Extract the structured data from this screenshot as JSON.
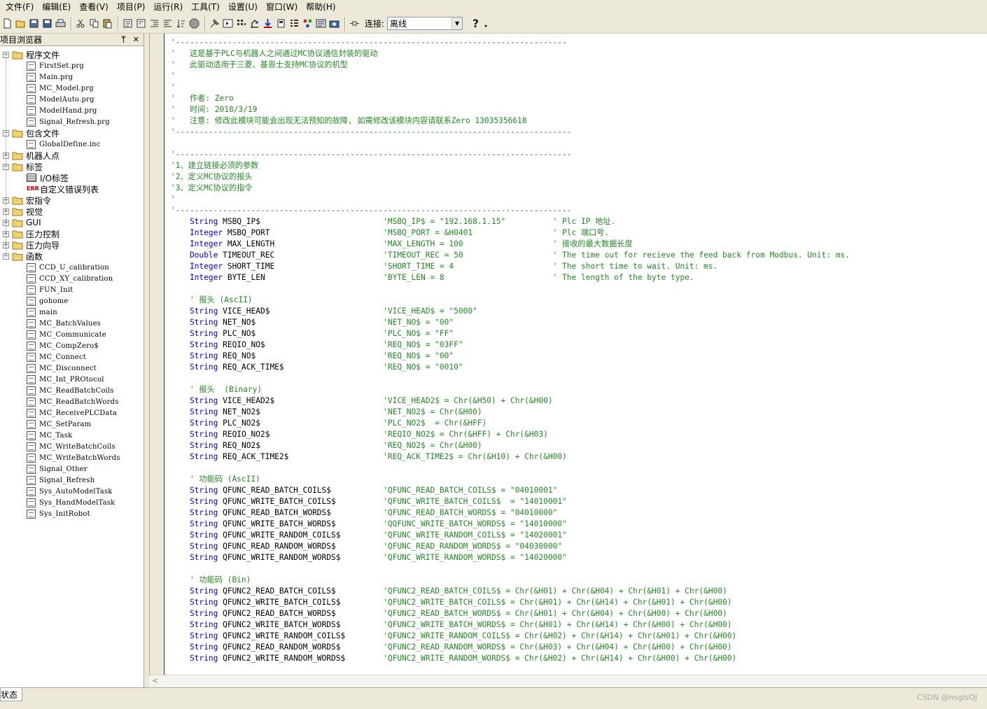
{
  "menu": [
    "文件(F)",
    "编辑(E)",
    "查看(V)",
    "项目(P)",
    "运行(R)",
    "工具(T)",
    "设置(U)",
    "窗口(W)",
    "帮助(H)"
  ],
  "toolbar": {
    "connection_label": "连接:",
    "connection_value": "离线",
    "help_icon": "?"
  },
  "sidebar": {
    "title": "项目浏览器",
    "pin_icon": "pin-icon",
    "close_icon": "close-icon",
    "tree": [
      {
        "label": "程序文件",
        "kind": "folder",
        "level": 0,
        "expanded": true
      },
      {
        "label": "FirstSet.prg",
        "kind": "file",
        "level": 1
      },
      {
        "label": "Main.prg",
        "kind": "file",
        "level": 1
      },
      {
        "label": "MC_Model.prg",
        "kind": "file",
        "level": 1
      },
      {
        "label": "ModelAuto.prg",
        "kind": "file",
        "level": 1
      },
      {
        "label": "ModelHand.prg",
        "kind": "file",
        "level": 1
      },
      {
        "label": "Signal_Refresh.prg",
        "kind": "file",
        "level": 1
      },
      {
        "label": "包含文件",
        "kind": "folder",
        "level": 0,
        "expanded": true
      },
      {
        "label": "GlobalDefine.inc",
        "kind": "file",
        "level": 1
      },
      {
        "label": "机器人点",
        "kind": "folder",
        "level": 0,
        "expanded": false
      },
      {
        "label": "标签",
        "kind": "folder",
        "level": 0,
        "expanded": true
      },
      {
        "label": "I/O标签",
        "kind": "io",
        "level": 1
      },
      {
        "label": "自定义错误列表",
        "kind": "err",
        "level": 1
      },
      {
        "label": "宏指令",
        "kind": "folder",
        "level": 0,
        "expanded": false
      },
      {
        "label": "视觉",
        "kind": "folder",
        "level": 0,
        "expanded": false
      },
      {
        "label": "GUI",
        "kind": "folder",
        "level": 0,
        "expanded": false
      },
      {
        "label": "压力控制",
        "kind": "folder",
        "level": 0,
        "expanded": false
      },
      {
        "label": "压力向导",
        "kind": "folder",
        "level": 0,
        "expanded": false
      },
      {
        "label": "函数",
        "kind": "folder",
        "level": 0,
        "expanded": true
      },
      {
        "label": "CCD_U_calibration",
        "kind": "file",
        "level": 1
      },
      {
        "label": "CCD_XY_calibration",
        "kind": "file",
        "level": 1
      },
      {
        "label": "FUN_Init",
        "kind": "file",
        "level": 1
      },
      {
        "label": "gohome",
        "kind": "file",
        "level": 1
      },
      {
        "label": "main",
        "kind": "file",
        "level": 1
      },
      {
        "label": "MC_BatchValues",
        "kind": "file",
        "level": 1
      },
      {
        "label": "MC_Communicate",
        "kind": "file",
        "level": 1
      },
      {
        "label": "MC_CompZero$",
        "kind": "file",
        "level": 1
      },
      {
        "label": "MC_Connect",
        "kind": "file",
        "level": 1
      },
      {
        "label": "MC_Disconnect",
        "kind": "file",
        "level": 1
      },
      {
        "label": "MC_Int_PROtocol",
        "kind": "file",
        "level": 1
      },
      {
        "label": "MC_ReadBatchCoils",
        "kind": "file",
        "level": 1
      },
      {
        "label": "MC_ReadBatchWords",
        "kind": "file",
        "level": 1
      },
      {
        "label": "MC_ReceivePLCData",
        "kind": "file",
        "level": 1
      },
      {
        "label": "MC_SetParam",
        "kind": "file",
        "level": 1
      },
      {
        "label": "MC_Task",
        "kind": "file",
        "level": 1
      },
      {
        "label": "MC_WriteBatchCoils",
        "kind": "file",
        "level": 1
      },
      {
        "label": "MC_WriteBatchWords",
        "kind": "file",
        "level": 1
      },
      {
        "label": "Signal_Other",
        "kind": "file",
        "level": 1
      },
      {
        "label": "Signal_Refresh",
        "kind": "file",
        "level": 1
      },
      {
        "label": "Sys_AutoModelTask",
        "kind": "file",
        "level": 1
      },
      {
        "label": "Sys_HandModelTask",
        "kind": "file",
        "level": 1
      },
      {
        "label": "Sys_InitRobot",
        "kind": "file",
        "level": 1
      }
    ]
  },
  "code_lines": [
    [
      [
        "cm",
        "'-----------------------------------------------------------------------------------"
      ]
    ],
    [
      [
        "cm",
        "'   这是基于PLC与机器人之间通过MC协议通信封装的驱动"
      ]
    ],
    [
      [
        "cm",
        "'   此驱动适用于三菱、基恩士支持MC协议的机型"
      ]
    ],
    [
      [
        "cm",
        "'"
      ]
    ],
    [
      [
        "cm",
        "'"
      ]
    ],
    [
      [
        "cm",
        "'   作者: Zero"
      ]
    ],
    [
      [
        "cm",
        "'   时间: 2018/3/19"
      ]
    ],
    [
      [
        "cm",
        "'   注意: 修改此模块可能会出现无法预知的故障, 如需修改该模块内容请联系Zero 13035356618"
      ]
    ],
    [
      [
        "cm",
        "'------------------------------------------------------------------------------------"
      ]
    ],
    [
      [
        "cm",
        ""
      ]
    ],
    [
      [
        "cm",
        "'------------------------------------------------------------------------------------"
      ]
    ],
    [
      [
        "cm",
        "'1、建立链接必须的参数"
      ]
    ],
    [
      [
        "cm",
        "'2、定义MC协议的报头"
      ]
    ],
    [
      [
        "cm",
        "'3、定义MC协议的指令"
      ]
    ],
    [
      [
        "cm",
        "'"
      ]
    ],
    [
      [
        "cm",
        "'------------------------------------------------------------------------------------"
      ]
    ],
    [
      [
        "kw",
        "    String"
      ],
      [
        "id",
        " MSBQ_IP$                          "
      ],
      [
        "cm",
        "'MSBQ_IP$ = \"192.168.1.15\"          ' Plc IP 地址."
      ]
    ],
    [
      [
        "kw",
        "    Integer"
      ],
      [
        "id",
        " MSBQ_PORT                        "
      ],
      [
        "cm",
        "'MSBQ_PORT = &H0401                 ' Plc 端口号."
      ]
    ],
    [
      [
        "kw",
        "    Integer"
      ],
      [
        "id",
        " MAX_LENGTH                       "
      ],
      [
        "cm",
        "'MAX_LENGTH = 100                   ' 接收的最大数据长度"
      ]
    ],
    [
      [
        "kw",
        "    Double"
      ],
      [
        "id",
        " TIMEOUT_REC                       "
      ],
      [
        "cm",
        "'TIMEOUT_REC = 50                   ' The time out for recieve the feed back from Modbus. Unit: ms."
      ]
    ],
    [
      [
        "kw",
        "    Integer"
      ],
      [
        "id",
        " SHORT_TIME                       "
      ],
      [
        "cm",
        "'SHORT_TIME = 4                     ' The short time to wait. Unit: ms."
      ]
    ],
    [
      [
        "kw",
        "    Integer"
      ],
      [
        "id",
        " BYTE_LEN                         "
      ],
      [
        "cm",
        "'BYTE_LEN = 8                       ' The length of the byte type."
      ]
    ],
    [
      [
        "cm",
        ""
      ]
    ],
    [
      [
        "cm",
        "    ' 报头 (AscII)"
      ]
    ],
    [
      [
        "kw",
        "    String"
      ],
      [
        "id",
        " VICE_HEAD$                        "
      ],
      [
        "cm",
        "'VICE_HEAD$ = \"5000\""
      ]
    ],
    [
      [
        "kw",
        "    String"
      ],
      [
        "id",
        " NET_NO$                           "
      ],
      [
        "cm",
        "'NET_NO$ = \"00\""
      ]
    ],
    [
      [
        "kw",
        "    String"
      ],
      [
        "id",
        " PLC_NO$                           "
      ],
      [
        "cm",
        "'PLC_NO$ = \"FF\""
      ]
    ],
    [
      [
        "kw",
        "    String"
      ],
      [
        "id",
        " REQIO_NO$                         "
      ],
      [
        "cm",
        "'REQ_NO$ = \"03FF\""
      ]
    ],
    [
      [
        "kw",
        "    String"
      ],
      [
        "id",
        " REQ_NO$                           "
      ],
      [
        "cm",
        "'REQ_NO$ = \"00\""
      ]
    ],
    [
      [
        "kw",
        "    String"
      ],
      [
        "id",
        " REQ_ACK_TIME$                     "
      ],
      [
        "cm",
        "'REQ_NO$ = \"0010\""
      ]
    ],
    [
      [
        "cm",
        ""
      ]
    ],
    [
      [
        "cm",
        "    ' 报头  (Binary)"
      ]
    ],
    [
      [
        "kw",
        "    String"
      ],
      [
        "id",
        " VICE_HEAD2$                       "
      ],
      [
        "cm",
        "'VICE_HEAD2$ = Chr(&H50) + Chr(&H00)"
      ]
    ],
    [
      [
        "kw",
        "    String"
      ],
      [
        "id",
        " NET_NO2$                          "
      ],
      [
        "cm",
        "'NET_NO2$ = Chr(&H00)"
      ]
    ],
    [
      [
        "kw",
        "    String"
      ],
      [
        "id",
        " PLC_NO2$                          "
      ],
      [
        "cm",
        "'PLC_NO2$  = Chr(&HFF)"
      ]
    ],
    [
      [
        "kw",
        "    String"
      ],
      [
        "id",
        " REQIO_NO2$                        "
      ],
      [
        "cm",
        "'REQIO_NO2$ = Chr(&HFF) + Chr(&H03)"
      ]
    ],
    [
      [
        "kw",
        "    String"
      ],
      [
        "id",
        " REQ_NO2$                          "
      ],
      [
        "cm",
        "'REQ_NO2$ = Chr(&H00)"
      ]
    ],
    [
      [
        "kw",
        "    String"
      ],
      [
        "id",
        " REQ_ACK_TIME2$                    "
      ],
      [
        "cm",
        "'REQ_ACK_TIME2$ = Chr(&H10) + Chr(&H00)"
      ]
    ],
    [
      [
        "cm",
        ""
      ]
    ],
    [
      [
        "cm",
        "    ' 功能码 (AscII)"
      ]
    ],
    [
      [
        "kw",
        "    String"
      ],
      [
        "id",
        " QFUNC_READ_BATCH_COILS$           "
      ],
      [
        "cm",
        "'QFUNC_READ_BATCH_COILS$ = \"04010001\""
      ]
    ],
    [
      [
        "kw",
        "    String"
      ],
      [
        "id",
        " QFUNC_WRITE_BATCH_COILS$          "
      ],
      [
        "cm",
        "'QFUNC_WRITE_BATCH_COILS$  = \"14010001\""
      ]
    ],
    [
      [
        "kw",
        "    String"
      ],
      [
        "id",
        " QFUNC_READ_BATCH_WORDS$           "
      ],
      [
        "cm",
        "'QFUNC_READ_BATCH_WORDS$ = \"04010000\""
      ]
    ],
    [
      [
        "kw",
        "    String"
      ],
      [
        "id",
        " QFUNC_WRITE_BATCH_WORDS$          "
      ],
      [
        "cm",
        "'QQFUNC_WRITE_BATCH_WORDS$ = \"14010000\""
      ]
    ],
    [
      [
        "kw",
        "    String"
      ],
      [
        "id",
        " QFUNC_WRITE_RANDOM_COILS$         "
      ],
      [
        "cm",
        "'QFUNC_WRITE_RANDOM_COILS$ = \"14020001\""
      ]
    ],
    [
      [
        "kw",
        "    String"
      ],
      [
        "id",
        " QFUNC_READ_RANDOM_WORDS$          "
      ],
      [
        "cm",
        "'QFUNC_READ_RANDOM_WORDS$ = \"04030000\""
      ]
    ],
    [
      [
        "kw",
        "    String"
      ],
      [
        "id",
        " QFUNC_WRITE_RANDOM_WORDS$         "
      ],
      [
        "cm",
        "'QFUNC_WRITE_RANDOM_WORDS$ = \"14020000\""
      ]
    ],
    [
      [
        "cm",
        ""
      ]
    ],
    [
      [
        "cm",
        "    ' 功能码 (Bin)"
      ]
    ],
    [
      [
        "kw",
        "    String"
      ],
      [
        "id",
        " QFUNC2_READ_BATCH_COILS$          "
      ],
      [
        "cm",
        "'QFUNC2_READ_BATCH_COILS$ = Chr(&H01) + Chr(&H04) + Chr(&H01) + Chr(&H00)"
      ]
    ],
    [
      [
        "kw",
        "    String"
      ],
      [
        "id",
        " QFUNC2_WRITE_BATCH_COILS$         "
      ],
      [
        "cm",
        "'QFUNC2_WRITE_BATCH_COILS$ = Chr(&H01) + Chr(&H14) + Chr(&H01) + Chr(&H00)"
      ]
    ],
    [
      [
        "kw",
        "    String"
      ],
      [
        "id",
        " QFUNC2_READ_BATCH_WORDS$          "
      ],
      [
        "cm",
        "'QFUNC2_READ_BATCH_WORDS$ = Chr(&H01) + Chr(&H04) + Chr(&H00) + Chr(&H00)"
      ]
    ],
    [
      [
        "kw",
        "    String"
      ],
      [
        "id",
        " QFUNC2_WRITE_BATCH_WORDS$         "
      ],
      [
        "cm",
        "'QFUNC2_WRITE_BATCH_WORDS$ = Chr(&H01) + Chr(&H14) + Chr(&H00) + Chr(&H00)"
      ]
    ],
    [
      [
        "kw",
        "    String"
      ],
      [
        "id",
        " QFUNC2_WRITE_RANDOM_COILS$        "
      ],
      [
        "cm",
        "'QFUNC2_WRITE_RANDOM_COILS$ = Chr(&H02) + Chr(&H14) + Chr(&H01) + Chr(&H00)"
      ]
    ],
    [
      [
        "kw",
        "    String"
      ],
      [
        "id",
        " QFUNC2_READ_RANDOM_WORDS$         "
      ],
      [
        "cm",
        "'QFUNC2_READ_RANDOM_WORDS$ = Chr(&H03) + Chr(&H04) + Chr(&H00) + Chr(&H00)"
      ]
    ],
    [
      [
        "kw",
        "    String"
      ],
      [
        "id",
        " QFUNC2_WRITE_RANDOM_WORDS$        "
      ],
      [
        "cm",
        "'QFUNC2_WRITE_RANDOM_WORDS$ = Chr(&H02) + Chr(&H14) + Chr(&H00) + Chr(&H00)"
      ]
    ]
  ],
  "scroll_arrow": "<",
  "status": {
    "tab_label": "状态"
  },
  "watermark": "CSDN @nsglsOJ"
}
